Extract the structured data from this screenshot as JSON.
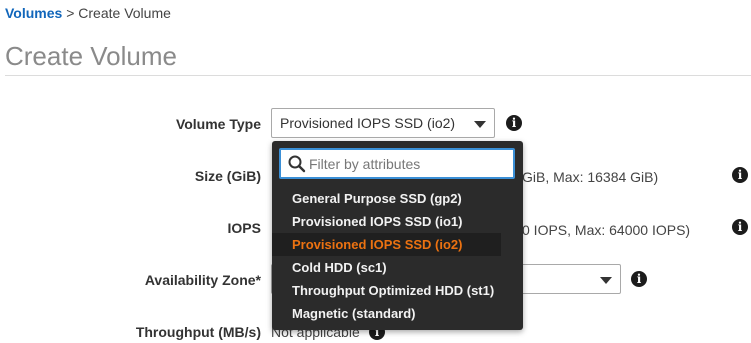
{
  "breadcrumb": {
    "parent": "Volumes",
    "separator": ">",
    "current": "Create Volume"
  },
  "page_title": "Create Volume",
  "form": {
    "volume_type": {
      "label": "Volume Type",
      "value": "Provisioned IOPS SSD (io2)"
    },
    "size": {
      "label": "Size (GiB)",
      "hint_visible": "GiB, Max: 16384 GiB)"
    },
    "iops": {
      "label": "IOPS",
      "hint_visible": "0 IOPS, Max: 64000 IOPS)"
    },
    "availability_zone": {
      "label": "Availability Zone*"
    },
    "throughput": {
      "label": "Throughput (MB/s)",
      "value": "Not applicable"
    }
  },
  "dropdown": {
    "filter_placeholder": "Filter by attributes",
    "options": [
      "General Purpose SSD (gp2)",
      "Provisioned IOPS SSD (io1)",
      "Provisioned IOPS SSD (io2)",
      "Cold HDD (sc1)",
      "Throughput Optimized HDD (st1)",
      "Magnetic (standard)"
    ],
    "selected_index": 2
  },
  "icons": {
    "info": "info-icon",
    "search": "search-icon",
    "dropdown_caret": "chevron-down-icon"
  },
  "colors": {
    "link": "#1166bb",
    "selected_option": "#ec7211",
    "dropdown_bg": "#2b2b2b",
    "filter_border": "#3a8fd6"
  }
}
